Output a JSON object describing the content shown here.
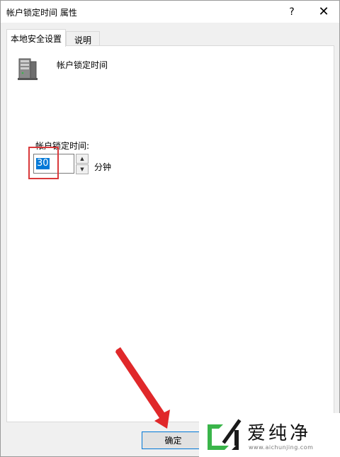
{
  "window": {
    "title": "帐户锁定时间 属性",
    "help_glyph": "?",
    "close_glyph": "✕"
  },
  "tabs": [
    {
      "label": "本地安全设置",
      "selected": true
    },
    {
      "label": "说明",
      "selected": false
    }
  ],
  "policy": {
    "icon": "server-icon",
    "name": "帐户锁定时间"
  },
  "duration": {
    "label": "帐户锁定时间:",
    "value": "30",
    "unit": "分钟"
  },
  "buttons": {
    "ok_label": "确定"
  },
  "annotation": {
    "highlight_color": "#d9393b",
    "arrow_color": "#e0282a"
  },
  "watermark": {
    "name": "爱纯净",
    "url": "www.aichunjing.com",
    "logo_color": "#3ab54a"
  },
  "colors": {
    "selection": "#0078d7",
    "dialog_bg": "#f0f0f0"
  }
}
